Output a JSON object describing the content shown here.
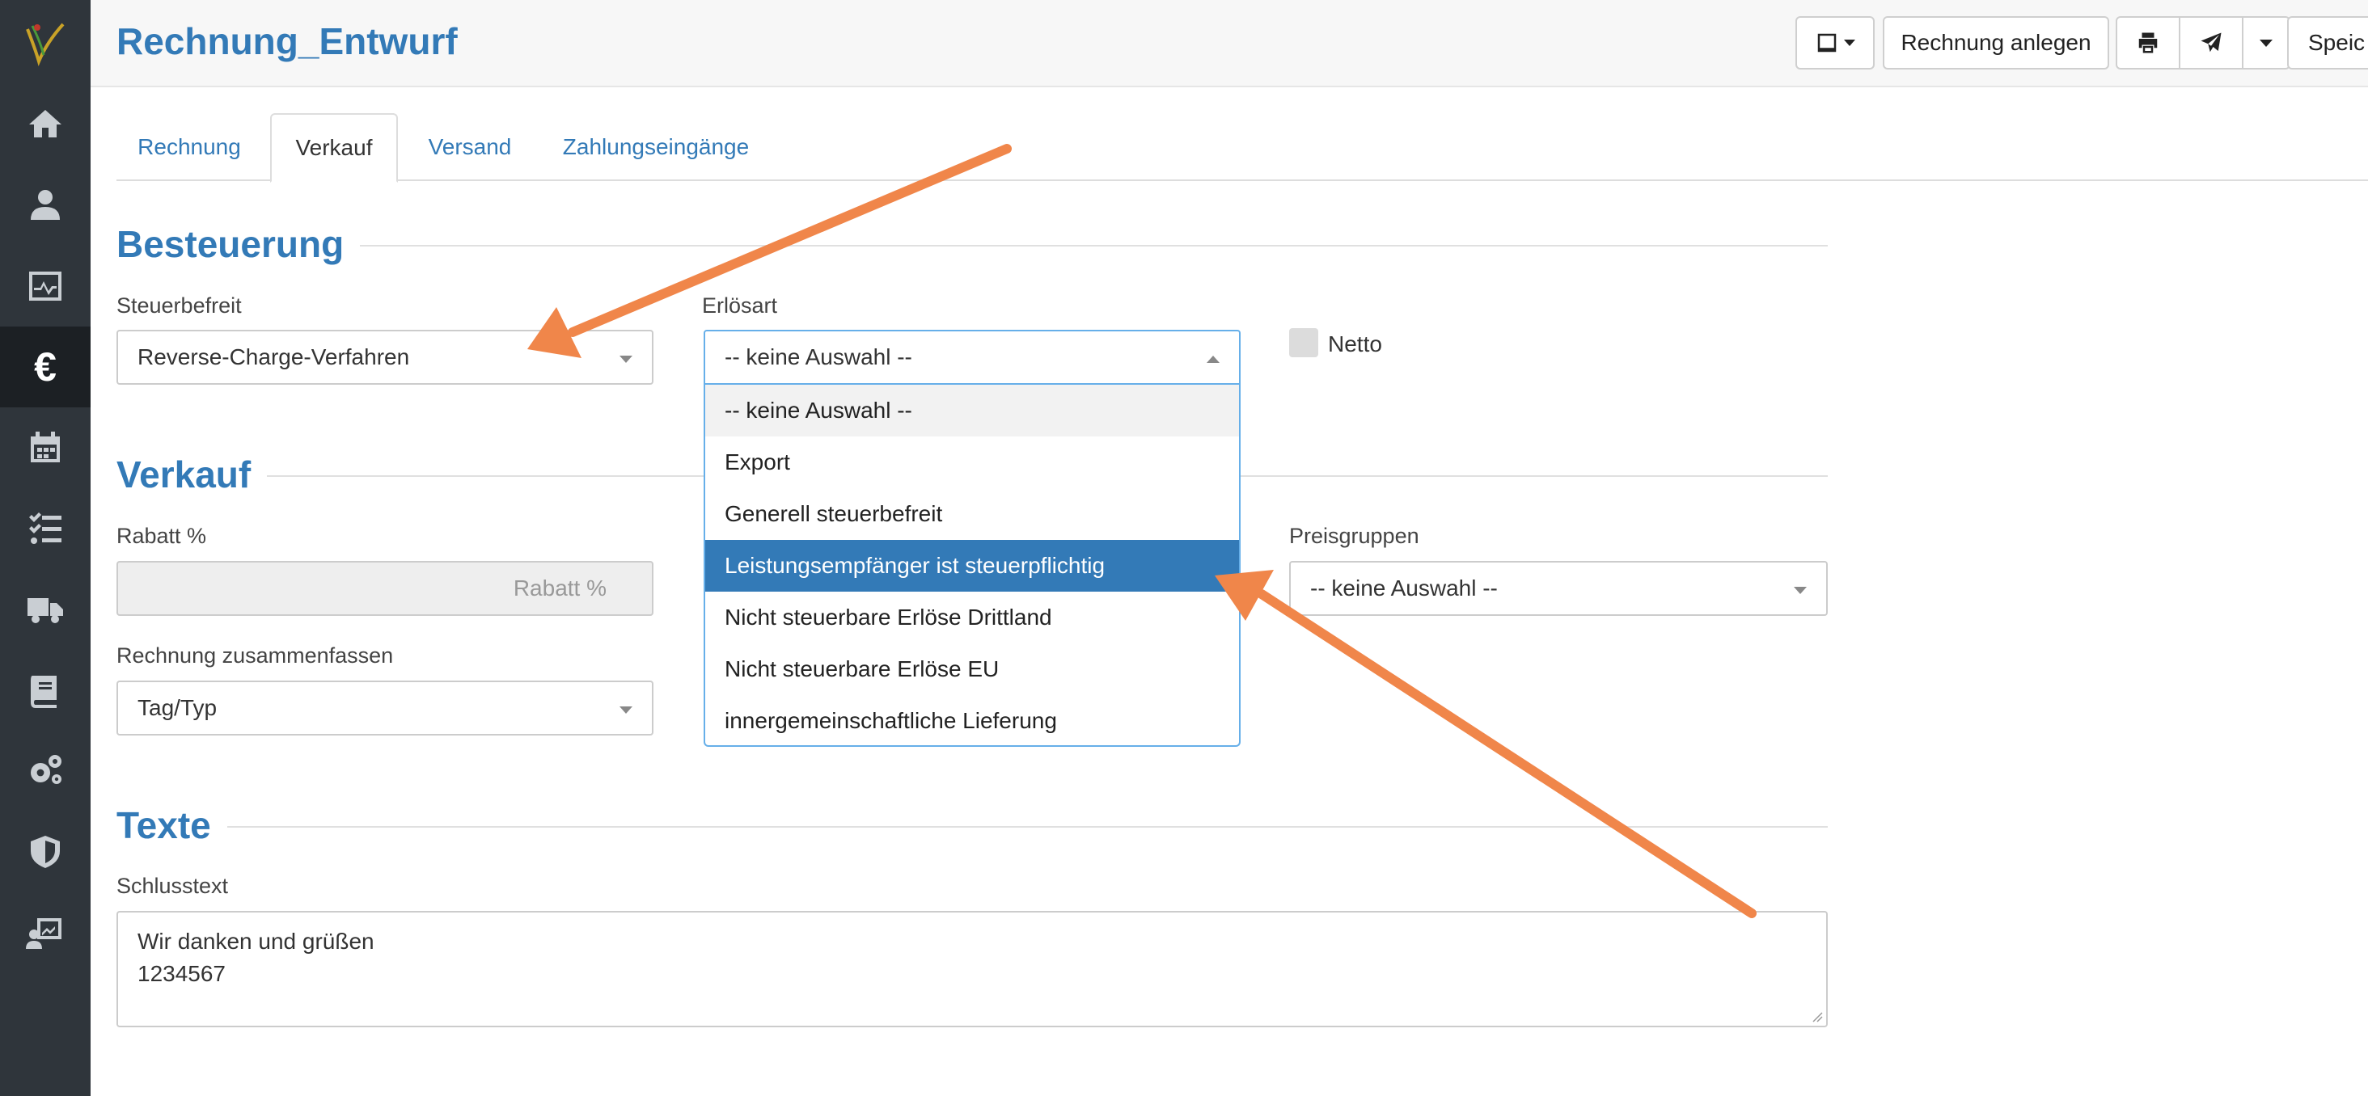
{
  "sidebar": {
    "logo_icon": "app-logo-icon",
    "items": [
      {
        "icon": "home-icon",
        "active": false
      },
      {
        "icon": "contacts-icon",
        "active": false
      },
      {
        "icon": "activity-monitor-icon",
        "active": false
      },
      {
        "icon": "euro-icon",
        "symbol": "€",
        "active": true
      },
      {
        "icon": "calendar-icon",
        "active": false
      },
      {
        "icon": "task-list-icon",
        "active": false
      },
      {
        "icon": "truck-icon",
        "active": false
      },
      {
        "icon": "book-icon",
        "active": false
      },
      {
        "icon": "settings-gears-icon",
        "active": false
      },
      {
        "icon": "shield-icon",
        "active": false
      },
      {
        "icon": "user-chart-icon",
        "active": false
      }
    ]
  },
  "header": {
    "title": "Rechnung_Entwurf",
    "buttons": {
      "device_dropdown_icon": "tablet-icon",
      "create_invoice": "Rechnung anlegen",
      "print_icon": "print-icon",
      "send_icon": "paper-plane-icon",
      "send_more_icon": "caret-down-icon",
      "save": "Speic"
    }
  },
  "tabs": [
    "Rechnung",
    "Verkauf",
    "Versand",
    "Zahlungseingänge"
  ],
  "active_tab": "Verkauf",
  "besteuerung": {
    "title": "Besteuerung",
    "steuerbefreit_label": "Steuerbefreit",
    "steuerbefreit_value": "Reverse-Charge-Verfahren",
    "erloesart_label": "Erlösart",
    "erloesart_value": "-- keine Auswahl --",
    "netto_label": "Netto",
    "netto_checked": false,
    "erloesart_options": [
      {
        "label": "-- keine Auswahl --",
        "state": "hover"
      },
      {
        "label": "Export",
        "state": "normal"
      },
      {
        "label": "Generell steuerbefreit",
        "state": "normal"
      },
      {
        "label": "Leistungsempfänger ist steuerpflichtig",
        "state": "selected"
      },
      {
        "label": "Nicht steuerbare Erlöse Drittland",
        "state": "normal"
      },
      {
        "label": "Nicht steuerbare Erlöse EU",
        "state": "normal"
      },
      {
        "label": "innergemeinschaftliche Lieferung",
        "state": "normal"
      }
    ]
  },
  "verkauf": {
    "title": "Verkauf",
    "rabatt_label": "Rabatt %",
    "rabatt_placeholder": "Rabatt %",
    "preisgruppen_label": "Preisgruppen",
    "preisgruppen_value": "-- keine Auswahl --",
    "zusammenfassen_label": "Rechnung zusammenfassen",
    "zusammenfassen_value": "Tag/Typ"
  },
  "texte": {
    "title": "Texte",
    "schlusstext_label": "Schlusstext",
    "schlusstext_lines": [
      "Wir danken und grüßen",
      "1234567"
    ]
  },
  "annotation_color": "#f0864a"
}
